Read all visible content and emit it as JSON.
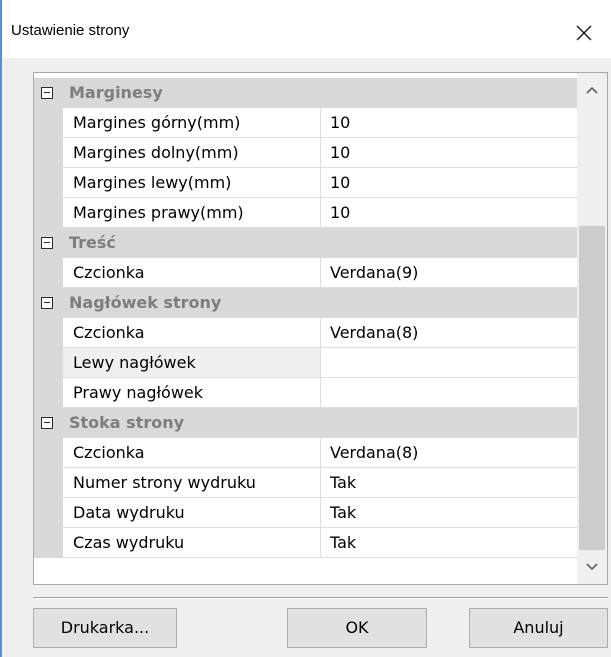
{
  "window": {
    "title": "Ustawienie strony",
    "close_symbol": "✕"
  },
  "property_grid": {
    "categories": [
      {
        "label": "Marginesy",
        "expanded": true,
        "properties": [
          {
            "name": "Margines górny(mm)",
            "value": "10"
          },
          {
            "name": "Margines dolny(mm)",
            "value": "10"
          },
          {
            "name": "Margines lewy(mm)",
            "value": "10"
          },
          {
            "name": "Margines prawy(mm)",
            "value": "10"
          }
        ]
      },
      {
        "label": "Treść",
        "expanded": true,
        "properties": [
          {
            "name": "Czcionka",
            "value": "Verdana(9)"
          }
        ]
      },
      {
        "label": "Nagłówek strony",
        "expanded": true,
        "properties": [
          {
            "name": "Czcionka",
            "value": "Verdana(8)"
          },
          {
            "name": "Lewy nagłówek",
            "value": ""
          },
          {
            "name": "Prawy nagłówek",
            "value": ""
          }
        ]
      },
      {
        "label": "Stoka strony",
        "expanded": true,
        "properties": [
          {
            "name": "Czcionka",
            "value": "Verdana(8)"
          },
          {
            "name": "Numer strony wydruku",
            "value": "Tak"
          },
          {
            "name": "Data wydruku",
            "value": "Tak"
          },
          {
            "name": "Czas wydruku",
            "value": "Tak"
          }
        ]
      }
    ]
  },
  "buttons": {
    "printer": "Drukarka...",
    "ok": "OK",
    "cancel": "Anuluj"
  },
  "colors": {
    "category_background": "#d9d9d9",
    "category_text": "#7d7d7d",
    "window_edge": "#5a8fd0"
  }
}
